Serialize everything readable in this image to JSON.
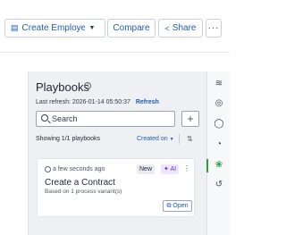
{
  "toolbar": {
    "create_label": "Create Employe...",
    "compare_label": "Compare",
    "share_label": "Share",
    "more_label": "···"
  },
  "panel": {
    "title": "Playbooks",
    "last_refresh_label": "Last refresh: 2026-01-14 05:50:37",
    "refresh_link": "Refresh",
    "search_placeholder": "Search",
    "add_label": "+",
    "showing_text": "Showing 1/1 playbooks",
    "sort_label": "Created on",
    "cards": [
      {
        "time": "a few seconds ago",
        "badge_new": "New",
        "badge_ai": "AI",
        "title": "Create a Contract",
        "subtitle": "Based on 1 process variant(s)",
        "open_label": "Open"
      }
    ]
  },
  "rail": {
    "icons": [
      "sliders-icon",
      "target-icon",
      "chat-icon",
      "gauge-icon",
      "playbook-icon",
      "history-icon"
    ],
    "active_color": "#2a9d3f"
  },
  "colors": {
    "accent": "#1f5bb5",
    "panel_bg": "#eef0f3"
  }
}
